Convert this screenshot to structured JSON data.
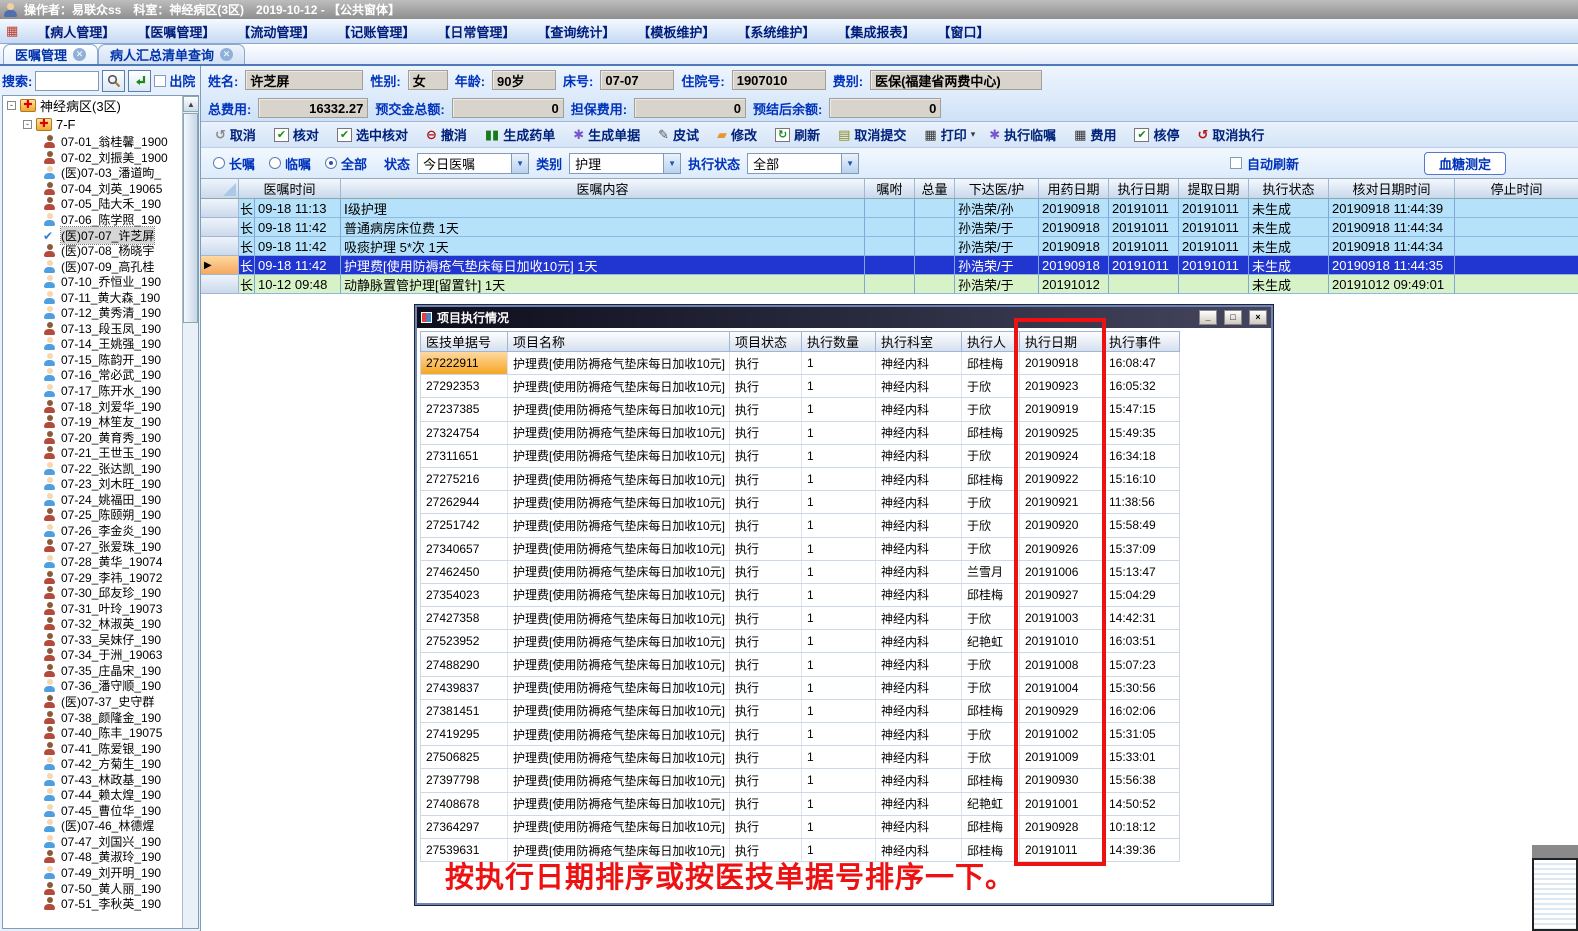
{
  "colors": {
    "accent_blue": "#0033bb",
    "selected_row_blue": "#2135d0",
    "row_light_blue": "#b5e2fa",
    "row_light_green": "#d8f2c8",
    "annotation_red": "#ee1111",
    "doc_highlight_orange": "#f5a623"
  },
  "title_bar": {
    "text": "操作者：易联众ss　科室：神经病区(3区)　2019-10-12 - 【公共窗体】"
  },
  "menu": {
    "items": [
      {
        "label": "【病人管理】"
      },
      {
        "label": "【医嘱管理】"
      },
      {
        "label": "【流动管理】"
      },
      {
        "label": "【记账管理】"
      },
      {
        "label": "【日常管理】"
      },
      {
        "label": "【查询统计】"
      },
      {
        "label": "【模板维护】"
      },
      {
        "label": "【系统维护】"
      },
      {
        "label": "【集成报表】"
      },
      {
        "label": "【窗口】"
      }
    ]
  },
  "tabs": [
    {
      "label": "医嘱管理",
      "cls": "active"
    },
    {
      "label": "病人汇总清单查询",
      "cls": "inactive"
    }
  ],
  "sidebar": {
    "search_label": "搜索:",
    "discharge_label": "出院",
    "tree": {
      "root": "神经病区(3区)",
      "group": "7-F",
      "patients": [
        {
          "label": "07-01_翁桂馨_1900",
          "icon": "female",
          "cls": ""
        },
        {
          "label": "07-02_刘振美_1900",
          "icon": "female",
          "cls": ""
        },
        {
          "label": "(医)07-03_潘道昫_",
          "icon": "male",
          "cls": ""
        },
        {
          "label": "07-04_刘英_19065",
          "icon": "female",
          "cls": ""
        },
        {
          "label": "07-05_陆大禾_190",
          "icon": "female",
          "cls": ""
        },
        {
          "label": "07-06_陈学照_190",
          "icon": "male",
          "cls": ""
        },
        {
          "label": "(医)07-07_许芝屏",
          "icon": "check",
          "cls": "sel"
        },
        {
          "label": "(医)07-08_杨晓宇",
          "icon": "female",
          "cls": ""
        },
        {
          "label": "(医)07-09_高孔桂",
          "icon": "male",
          "cls": ""
        },
        {
          "label": "07-10_乔恒业_190",
          "icon": "male",
          "cls": ""
        },
        {
          "label": "07-11_黄大森_190",
          "icon": "male",
          "cls": ""
        },
        {
          "label": "07-12_黄秀清_190",
          "icon": "male",
          "cls": ""
        },
        {
          "label": "07-13_段玉凤_190",
          "icon": "female",
          "cls": ""
        },
        {
          "label": "07-14_王姚强_190",
          "icon": "male",
          "cls": ""
        },
        {
          "label": "07-15_陈韵开_190",
          "icon": "male",
          "cls": ""
        },
        {
          "label": "07-16_常必武_190",
          "icon": "male",
          "cls": ""
        },
        {
          "label": "07-17_陈开水_190",
          "icon": "male",
          "cls": ""
        },
        {
          "label": "07-18_刘爱华_190",
          "icon": "female",
          "cls": ""
        },
        {
          "label": "07-19_林笙友_190",
          "icon": "female",
          "cls": ""
        },
        {
          "label": "07-20_黄育秀_190",
          "icon": "female",
          "cls": ""
        },
        {
          "label": "07-21_王世玉_190",
          "icon": "female",
          "cls": ""
        },
        {
          "label": "07-22_张达凯_190",
          "icon": "male",
          "cls": ""
        },
        {
          "label": "07-23_刘木旺_190",
          "icon": "male",
          "cls": ""
        },
        {
          "label": "07-24_姚福田_190",
          "icon": "male",
          "cls": ""
        },
        {
          "label": "07-25_陈颐朔_190",
          "icon": "female",
          "cls": ""
        },
        {
          "label": "07-26_李金炎_190",
          "icon": "male",
          "cls": ""
        },
        {
          "label": "07-27_张爱珠_190",
          "icon": "female",
          "cls": ""
        },
        {
          "label": "07-28_黄华_19074",
          "icon": "male",
          "cls": ""
        },
        {
          "label": "07-29_李祎_19072",
          "icon": "female",
          "cls": ""
        },
        {
          "label": "07-30_邱友珍_190",
          "icon": "female",
          "cls": ""
        },
        {
          "label": "07-31_叶玲_19073",
          "icon": "female",
          "cls": ""
        },
        {
          "label": "07-32_林淑英_190",
          "icon": "female",
          "cls": ""
        },
        {
          "label": "07-33_吴妹仔_190",
          "icon": "female",
          "cls": ""
        },
        {
          "label": "07-34_于洲_19063",
          "icon": "female",
          "cls": ""
        },
        {
          "label": "07-35_庄晶宋_190",
          "icon": "female",
          "cls": ""
        },
        {
          "label": "07-36_潘守顺_190",
          "icon": "male",
          "cls": ""
        },
        {
          "label": "(医)07-37_史守群",
          "icon": "female",
          "cls": ""
        },
        {
          "label": "07-38_颜隆金_190",
          "icon": "female",
          "cls": ""
        },
        {
          "label": "07-40_陈丰_19075",
          "icon": "female",
          "cls": ""
        },
        {
          "label": "07-41_陈爱银_190",
          "icon": "female",
          "cls": ""
        },
        {
          "label": "07-42_方菊生_190",
          "icon": "male",
          "cls": ""
        },
        {
          "label": "07-43_林政基_190",
          "icon": "male",
          "cls": ""
        },
        {
          "label": "07-44_赖太煌_190",
          "icon": "male",
          "cls": ""
        },
        {
          "label": "07-45_曹位华_190",
          "icon": "male",
          "cls": ""
        },
        {
          "label": "(医)07-46_林德煋",
          "icon": "male",
          "cls": ""
        },
        {
          "label": "07-47_刘国兴_190",
          "icon": "male",
          "cls": ""
        },
        {
          "label": "07-48_黄淑玲_190",
          "icon": "female",
          "cls": ""
        },
        {
          "label": "07-49_刘开明_190",
          "icon": "male",
          "cls": ""
        },
        {
          "label": "07-50_黄人丽_190",
          "icon": "female",
          "cls": ""
        },
        {
          "label": "07-51_李秋英_190",
          "icon": "female",
          "cls": ""
        }
      ]
    }
  },
  "patient": {
    "name_label": "姓名:",
    "name": "许芝屏",
    "sex_label": "性别:",
    "sex": "女",
    "age_label": "年龄:",
    "age": "90岁",
    "bed_label": "床号:",
    "bed": "07-07",
    "admission_label": "住院号:",
    "admission": "1907010",
    "fee_type_label": "费别:",
    "fee_type": "医保(福建省两费中心)",
    "total_label": "总费用:",
    "total": "16332.27",
    "prepaid_label": "预交金总额:",
    "prepaid": "0",
    "guarantee_label": "担保费用:",
    "guarantee": "0",
    "balance_label": "预结后余额:",
    "balance": "0"
  },
  "toolbar": {
    "items": [
      {
        "name": "cancel-button",
        "icon": "undo-icon",
        "glyph": "↺",
        "color": "#8a8a8a",
        "cls": "",
        "label": "取消",
        "suffix": ""
      },
      {
        "name": "verify-button",
        "icon": "check-icon",
        "glyph": "✔",
        "color": "#1a8a1a",
        "cls": "box",
        "label": "核对",
        "suffix": ""
      },
      {
        "name": "verify-selected-button",
        "icon": "check-icon",
        "glyph": "✔",
        "color": "#1a8a1a",
        "cls": "box",
        "label": "选中核对",
        "suffix": ""
      },
      {
        "name": "revoke-button",
        "icon": "minus-circle-icon",
        "glyph": "⊖",
        "color": "#aa1111",
        "cls": "",
        "label": "撤消",
        "suffix": ""
      },
      {
        "name": "generate-med-list-button",
        "icon": "med-list-icon",
        "glyph": "▮▮",
        "color": "#1a7a1a",
        "cls": "",
        "label": "生成药单",
        "suffix": ""
      },
      {
        "name": "generate-doc-button",
        "icon": "gear-icon",
        "glyph": "✱",
        "color": "#7a55cc",
        "cls": "",
        "label": "生成单据",
        "suffix": ""
      },
      {
        "name": "skin-test-button",
        "icon": "pen-icon",
        "glyph": "✎",
        "color": "#555555",
        "cls": "",
        "label": "皮试",
        "suffix": ""
      },
      {
        "name": "modify-button",
        "icon": "eraser-icon",
        "glyph": "▰",
        "color": "#e8972f",
        "cls": "",
        "label": "修改",
        "suffix": ""
      },
      {
        "name": "refresh-button",
        "icon": "refresh-icon",
        "glyph": "↻",
        "color": "#1a8a1a",
        "cls": "box",
        "label": "刷新",
        "suffix": ""
      },
      {
        "name": "cancel-submit-button",
        "icon": "stack-icon",
        "glyph": "▤",
        "color": "#8a8a1a",
        "cls": "",
        "label": "取消提交",
        "suffix": ""
      },
      {
        "name": "print-button",
        "icon": "printer-icon",
        "glyph": "▦",
        "color": "#333333",
        "cls": "",
        "label": "打印",
        "suffix": "▾"
      },
      {
        "name": "exec-temp-order-button",
        "icon": "gear-icon",
        "glyph": "✱",
        "color": "#7a55cc",
        "cls": "",
        "label": "执行临嘱",
        "suffix": ""
      },
      {
        "name": "fee-button",
        "icon": "calculator-icon",
        "glyph": "▦",
        "color": "#333333",
        "cls": "",
        "label": "费用",
        "suffix": ""
      },
      {
        "name": "verify-stop-button",
        "icon": "check-icon",
        "glyph": "✔",
        "color": "#1a8a1a",
        "cls": "box",
        "label": "核停",
        "suffix": ""
      },
      {
        "name": "cancel-exec-button",
        "icon": "undo-red-icon",
        "glyph": "↺",
        "color": "#bb1111",
        "cls": "",
        "label": "取消执行",
        "suffix": ""
      }
    ]
  },
  "filters": {
    "radios": [
      {
        "label": "长嘱",
        "cls": ""
      },
      {
        "label": "临嘱",
        "cls": ""
      },
      {
        "label": "全部",
        "cls": "on"
      }
    ],
    "status_label": "状态",
    "status_value": "今日医嘱",
    "type_label": "类别",
    "type_value": "护理",
    "exec_label": "执行状态",
    "exec_value": "全部",
    "auto_refresh_label": "自动刷新",
    "glucose_button_label": "血糖测定"
  },
  "orders": {
    "columns": [
      {
        "label": "医嘱时间"
      },
      {
        "label": "医嘱内容"
      },
      {
        "label": "嘱咐"
      },
      {
        "label": "总量"
      },
      {
        "label": "下达医/护"
      },
      {
        "label": "用药日期"
      },
      {
        "label": "执行日期"
      },
      {
        "label": "提取日期"
      },
      {
        "label": "执行状态"
      },
      {
        "label": "核对日期时间"
      },
      {
        "label": "停止时间"
      }
    ],
    "rows": [
      {
        "cls": "row-blue",
        "marker": "",
        "type": "长",
        "time": "09-18 11:13",
        "content": "Ⅰ级护理",
        "advice": "",
        "total": "",
        "doctor": "孙浩荣/孙",
        "med_date": "20190918",
        "exec_date": "20191011",
        "extract_date": "20191011",
        "status": "未生成",
        "check_time": "20190918 11:44:39",
        "stop_time": ""
      },
      {
        "cls": "row-blue",
        "marker": "",
        "type": "长",
        "time": "09-18 11:42",
        "content": "普通病房床位费    1天",
        "advice": "",
        "total": "",
        "doctor": "孙浩荣/于",
        "med_date": "20190918",
        "exec_date": "20191011",
        "extract_date": "20191011",
        "status": "未生成",
        "check_time": "20190918 11:44:34",
        "stop_time": ""
      },
      {
        "cls": "row-blue",
        "marker": "",
        "type": "长",
        "time": "09-18 11:42",
        "content": "吸痰护理    5*次 1天",
        "advice": "",
        "total": "",
        "doctor": "孙浩荣/于",
        "med_date": "20190918",
        "exec_date": "20191011",
        "extract_date": "20191011",
        "status": "未生成",
        "check_time": "20190918 11:44:34",
        "stop_time": ""
      },
      {
        "cls": "row-sel",
        "marker": "▶",
        "type": "长",
        "time": "09-18 11:42",
        "content": "护理费[使用防褥疮气垫床每日加收10元]    1天",
        "advice": "",
        "total": "",
        "doctor": "孙浩荣/于",
        "med_date": "20190918",
        "exec_date": "20191011",
        "extract_date": "20191011",
        "status": "未生成",
        "check_time": "20190918 11:44:35",
        "stop_time": ""
      },
      {
        "cls": "row-green",
        "marker": "",
        "type": "长",
        "time": "10-12 09:48",
        "content": "动静脉置管护理[留置针]    1天",
        "advice": "",
        "total": "",
        "doctor": "孙浩荣/于",
        "med_date": "20191012",
        "exec_date": "",
        "extract_date": "",
        "status": "未生成",
        "check_time": "20191012 09:49:01",
        "stop_time": ""
      }
    ]
  },
  "dialog": {
    "title": "项目执行情况",
    "minimize_label": "_",
    "maximize_label": "□",
    "close_label": "×",
    "columns": [
      {
        "label": "医技单据号"
      },
      {
        "label": "项目名称"
      },
      {
        "label": "项目状态"
      },
      {
        "label": "执行数量"
      },
      {
        "label": "执行科室"
      },
      {
        "label": "执行人"
      },
      {
        "label": "执行日期"
      },
      {
        "label": "执行事件"
      }
    ],
    "common": {
      "name": "护理费[使用防褥疮气垫床每日加收10元]",
      "status": "执行",
      "qty": "1",
      "dept": "神经内科"
    },
    "rows": [
      {
        "cls": "first",
        "id": "27222911",
        "person": "邱桂梅",
        "date": "20190918",
        "time": "16:08:47"
      },
      {
        "cls": "",
        "id": "27292353",
        "person": "于欣",
        "date": "20190923",
        "time": "16:05:32"
      },
      {
        "cls": "",
        "id": "27237385",
        "person": "于欣",
        "date": "20190919",
        "time": "15:47:15"
      },
      {
        "cls": "",
        "id": "27324754",
        "person": "邱桂梅",
        "date": "20190925",
        "time": "15:49:35"
      },
      {
        "cls": "",
        "id": "27311651",
        "person": "于欣",
        "date": "20190924",
        "time": "16:34:18"
      },
      {
        "cls": "",
        "id": "27275216",
        "person": "邱桂梅",
        "date": "20190922",
        "time": "15:16:10"
      },
      {
        "cls": "",
        "id": "27262944",
        "person": "于欣",
        "date": "20190921",
        "time": "11:38:56"
      },
      {
        "cls": "",
        "id": "27251742",
        "person": "于欣",
        "date": "20190920",
        "time": "15:58:49"
      },
      {
        "cls": "",
        "id": "27340657",
        "person": "于欣",
        "date": "20190926",
        "time": "15:37:09"
      },
      {
        "cls": "",
        "id": "27462450",
        "person": "兰雪月",
        "date": "20191006",
        "time": "15:13:47"
      },
      {
        "cls": "",
        "id": "27354023",
        "person": "邱桂梅",
        "date": "20190927",
        "time": "15:04:29"
      },
      {
        "cls": "",
        "id": "27427358",
        "person": "于欣",
        "date": "20191003",
        "time": "14:42:31"
      },
      {
        "cls": "",
        "id": "27523952",
        "person": "纪艳虹",
        "date": "20191010",
        "time": "16:03:51"
      },
      {
        "cls": "",
        "id": "27488290",
        "person": "于欣",
        "date": "20191008",
        "time": "15:07:23"
      },
      {
        "cls": "",
        "id": "27439837",
        "person": "于欣",
        "date": "20191004",
        "time": "15:30:56"
      },
      {
        "cls": "",
        "id": "27381451",
        "person": "邱桂梅",
        "date": "20190929",
        "time": "16:02:06"
      },
      {
        "cls": "",
        "id": "27419295",
        "person": "于欣",
        "date": "20191002",
        "time": "15:31:05"
      },
      {
        "cls": "",
        "id": "27506825",
        "person": "于欣",
        "date": "20191009",
        "time": "15:33:01"
      },
      {
        "cls": "",
        "id": "27397798",
        "person": "邱桂梅",
        "date": "20190930",
        "time": "15:56:38"
      },
      {
        "cls": "",
        "id": "27408678",
        "person": "纪艳虹",
        "date": "20191001",
        "time": "14:50:52"
      },
      {
        "cls": "",
        "id": "27364297",
        "person": "邱桂梅",
        "date": "20190928",
        "time": "10:18:12"
      },
      {
        "cls": "",
        "id": "27539631",
        "person": "邱桂梅",
        "date": "20191011",
        "time": "14:39:36"
      }
    ],
    "note": "按执行日期排序或按医技单据号排序一下。"
  }
}
